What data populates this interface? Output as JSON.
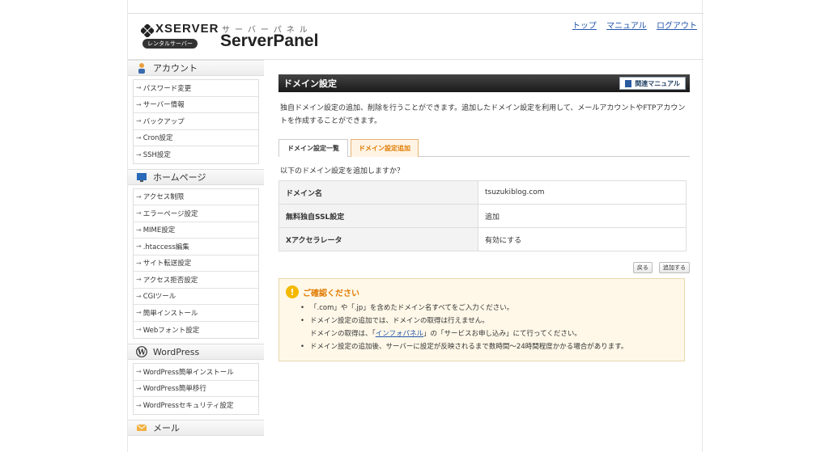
{
  "header": {
    "brand": "XSERVER",
    "brand_sub": "レンタルサーバー",
    "panel_kana": "サーバーパネル",
    "panel_title": "ServerPanel",
    "links": [
      "トップ",
      "マニュアル",
      "ログアウト"
    ]
  },
  "sidebar": {
    "sections": [
      {
        "title": "アカウント",
        "icon": "person-icon",
        "items": [
          "パスワード変更",
          "サーバー情報",
          "バックアップ",
          "Cron設定",
          "SSH設定"
        ]
      },
      {
        "title": "ホームページ",
        "icon": "monitor-icon",
        "items": [
          "アクセス制限",
          "エラーページ設定",
          "MIME設定",
          ".htaccess編集",
          "サイト転送設定",
          "アクセス拒否設定",
          "CGIツール",
          "簡単インストール",
          "Webフォント設定"
        ]
      },
      {
        "title": "WordPress",
        "icon": "wordpress-icon",
        "items": [
          "WordPress簡単インストール",
          "WordPress簡単移行",
          "WordPressセキュリティ設定"
        ]
      },
      {
        "title": "メール",
        "icon": "mail-icon",
        "items": []
      }
    ]
  },
  "main": {
    "title": "ドメイン設定",
    "manual_button": "関連マニュアル",
    "description": "独自ドメイン設定の追加、削除を行うことができます。追加したドメイン設定を利用して、メールアカウントやFTPアカウントを作成することができます。",
    "tabs": [
      "ドメイン設定一覧",
      "ドメイン設定追加"
    ],
    "question": "以下のドメイン設定を追加しますか？",
    "table": [
      {
        "key": "ドメイン名",
        "value": "tsuzukiblog.com"
      },
      {
        "key": "無料独自SSL設定",
        "value": "追加"
      },
      {
        "key": "Xアクセラレータ",
        "value": "有効にする"
      }
    ],
    "back_button": "戻る",
    "add_button": "追加する",
    "notice": {
      "title": "ご確認ください",
      "line1": "「.com」や「.jp」を含めたドメイン名すべてをご入力ください。",
      "line2": "ドメイン設定の追加では、ドメインの取得は行えません。",
      "line3_pre": "ドメインの取得は、「",
      "line3_link": "インフォパネル",
      "line3_post": "」の「サービスお申し込み」にて行ってください。",
      "line4": "ドメイン設定の追加後、サーバーに設定が反映されるまで数時間〜24時間程度かかる場合があります。"
    }
  }
}
